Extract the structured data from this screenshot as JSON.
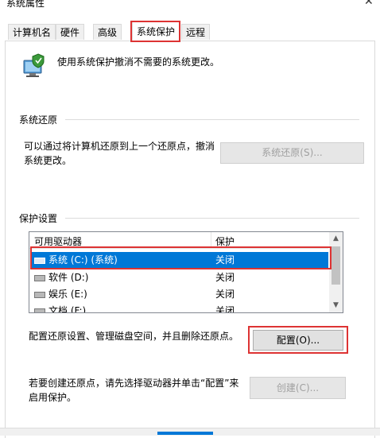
{
  "window": {
    "title": "系统属性",
    "close_glyph": "✕"
  },
  "tabs": [
    {
      "label": "计算机名"
    },
    {
      "label": "硬件"
    },
    {
      "label": "高级"
    },
    {
      "label": "系统保护",
      "active": true
    },
    {
      "label": "远程"
    }
  ],
  "intro_text": "使用系统保护撤消不需要的系统更改。",
  "restore": {
    "group_label": "系统还原",
    "desc_line1": "可以通过将计算机还原到上一个还原点，撤消",
    "desc_line2": "系统更改。",
    "button_label": "系统还原(S)..."
  },
  "protection": {
    "group_label": "保护设置",
    "columns": [
      "可用驱动器",
      "保护"
    ],
    "drives": [
      {
        "name": "系统 (C:) (系统)",
        "status": "关闭",
        "selected": true
      },
      {
        "name": "软件 (D:)",
        "status": "关闭"
      },
      {
        "name": "娱乐 (E:)",
        "status": "关闭"
      },
      {
        "name": "文档 (F:)",
        "status": "关闭"
      }
    ]
  },
  "configure": {
    "desc": "配置还原设置、管理磁盘空间，并且删除还原点。",
    "button_label": "配置(O)..."
  },
  "create": {
    "desc_line1": "若要创建还原点，请先选择驱动器并单击“配置”来",
    "desc_line2": "启用保护。",
    "button_label": "创建(C)..."
  },
  "colors": {
    "selection": "#0078d7",
    "highlight_border": "#dd3333"
  },
  "icons": {
    "system": "shield-computer-icon",
    "drive": "hard-drive-icon"
  }
}
